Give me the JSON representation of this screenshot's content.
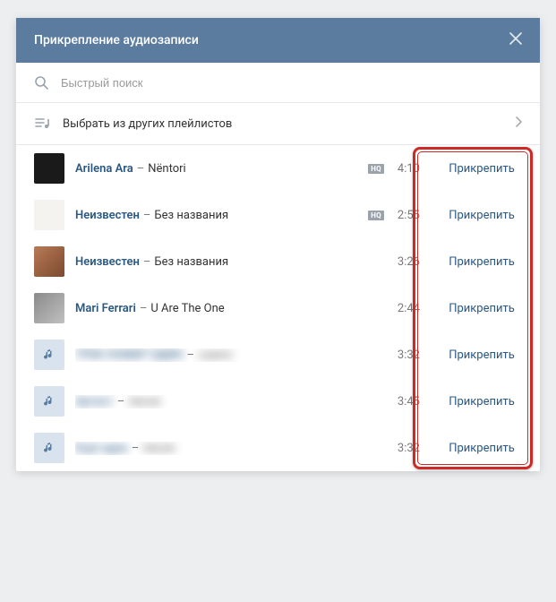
{
  "header": {
    "title": "Прикрепление аудиозаписи"
  },
  "search": {
    "placeholder": "Быстрый поиск"
  },
  "playlists_row": {
    "label": "Выбрать из других плейлистов"
  },
  "hq_label": "HQ",
  "attach_label": "Прикрепить",
  "tracks": [
    {
      "artist": "Arilena Ara",
      "title": "Nëntori",
      "duration": "4:10",
      "hq": true,
      "cover": "cv1",
      "blurred": false
    },
    {
      "artist": "Неизвестен",
      "title": "Без названия",
      "duration": "2:55",
      "hq": true,
      "cover": "cv2",
      "blurred": false
    },
    {
      "artist": "Неизвестен",
      "title": "Без названия",
      "duration": "3:26",
      "hq": false,
      "cover": "cv3",
      "blurred": false
    },
    {
      "artist": "Mari Ferrari",
      "title": "U Are The One",
      "duration": "2:44",
      "hq": false,
      "cover": "cv4",
      "blurred": false
    },
    {
      "artist": "ТРЕК НОМЕР ОДИН",
      "title": "сэмпл",
      "duration": "3:32",
      "hq": false,
      "cover": "note",
      "blurred": true
    },
    {
      "artist": "Артист",
      "title": "песня",
      "duration": "3:45",
      "hq": false,
      "cover": "note",
      "blurred": true
    },
    {
      "artist": "Ещё один",
      "title": "песня",
      "duration": "3:32",
      "hq": false,
      "cover": "note",
      "blurred": true
    }
  ]
}
